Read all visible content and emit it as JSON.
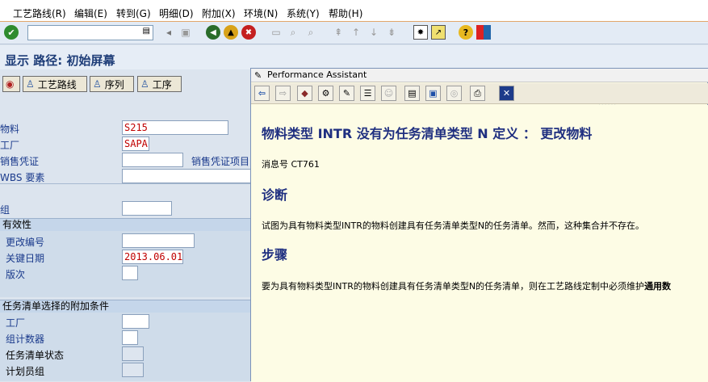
{
  "menu": [
    "工艺路线(R)",
    "编辑(E)",
    "转到(G)",
    "明细(D)",
    "附加(X)",
    "环境(N)",
    "系统(Y)",
    "帮助(H)"
  ],
  "page_title": "显示 路径: 初始屏幕",
  "app_toolbar": {
    "routing": "工艺路线",
    "sequence": "序列",
    "operation": "工序"
  },
  "fields": {
    "material": {
      "label": "物料",
      "value": "S215"
    },
    "plant": {
      "label": "工厂",
      "value": "SAPA"
    },
    "sales_doc": {
      "label": "销售凭证",
      "value": ""
    },
    "sales_doc_item": {
      "label": "销售凭证项目"
    },
    "wbs": {
      "label": "WBS 要素",
      "value": ""
    },
    "group": {
      "label": "组",
      "value": ""
    }
  },
  "validity": {
    "header": "有效性",
    "change_no": {
      "label": "更改编号",
      "value": ""
    },
    "key_date": {
      "label": "关键日期",
      "value": "2013.06.01"
    },
    "revision": {
      "label": "版次",
      "value": ""
    }
  },
  "addl": {
    "header": "任务清单选择的附加条件",
    "plant": {
      "label": "工厂",
      "value": ""
    },
    "group_counter": {
      "label": "组计数器",
      "value": ""
    },
    "status": {
      "label": "任务清单状态",
      "value": ""
    },
    "planner_group": {
      "label": "计划员组",
      "value": ""
    }
  },
  "pa": {
    "title": "Performance Assistant",
    "dots": "......",
    "heading": "物料类型  INTR 没有为任务清单类型  N 定义  ：   更改物料",
    "msg_no": "消息号  CT761",
    "diag_title": "诊断",
    "diag_text": "试图为具有物料类型INTR的物料创建具有任务清单类型N的任务清单。然而，这种集合并不存在。",
    "proc_title": "步骤",
    "proc_text": "要为具有物料类型INTR的物料创建具有任务清单类型N的任务清单，则在工艺路线定制中必须维护",
    "proc_bold": "通用数"
  }
}
